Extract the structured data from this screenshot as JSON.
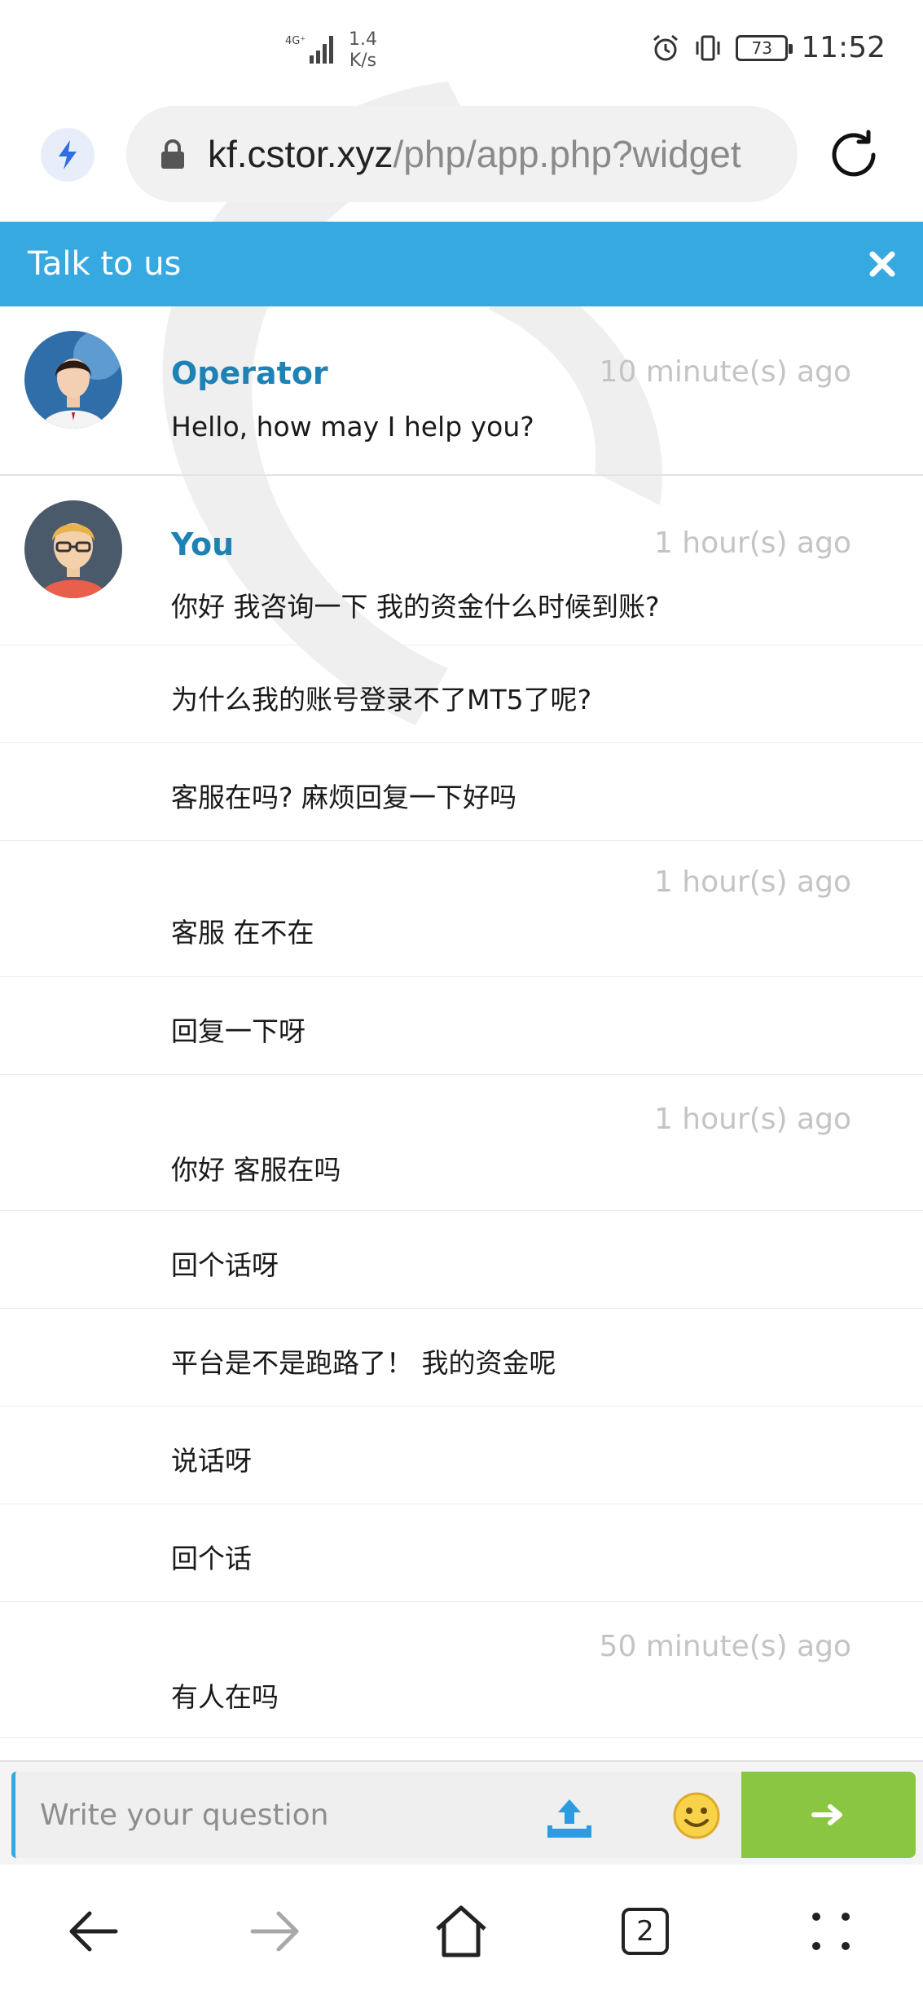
{
  "status_bar": {
    "network_type": "4G⁺",
    "net_speed_value": "1.4",
    "net_speed_unit": "K/s",
    "battery_level": "73",
    "time": "11:52"
  },
  "address_bar": {
    "url_host": "kf.cstor.xyz",
    "url_path": "/php/app.php?widget"
  },
  "widget": {
    "title": "Talk to us",
    "accent_color": "#37a9e1"
  },
  "messages": {
    "operator": {
      "sender": "Operator",
      "time": "10 minute(s) ago",
      "text": "Hello, how may I help you?"
    },
    "user_group": {
      "sender": "You",
      "time": "1 hour(s) ago",
      "lines": [
        {
          "time": "1 hour(s) ago",
          "text": "你好 我咨询一下 我的资金什么时候到账?"
        },
        {
          "time": "",
          "text": "为什么我的账号登录不了MT5了呢?"
        },
        {
          "time": "",
          "text": "客服在吗?  麻烦回复一下好吗"
        },
        {
          "time": "1 hour(s) ago",
          "text": "客服 在不在"
        },
        {
          "time": "",
          "text": "回复一下呀"
        },
        {
          "time": "1 hour(s) ago",
          "text": "你好 客服在吗"
        },
        {
          "time": "",
          "text": "回个话呀"
        },
        {
          "time": "",
          "text": "平台是不是跑路了！  我的资金呢"
        },
        {
          "time": "",
          "text": "说话呀"
        },
        {
          "time": "",
          "text": "回个话"
        },
        {
          "time": "50 minute(s) ago",
          "text": "有人在吗"
        }
      ]
    }
  },
  "composer": {
    "placeholder": "Write your question",
    "send_color": "#8ac642"
  },
  "bottom_nav": {
    "tab_count": "2"
  }
}
